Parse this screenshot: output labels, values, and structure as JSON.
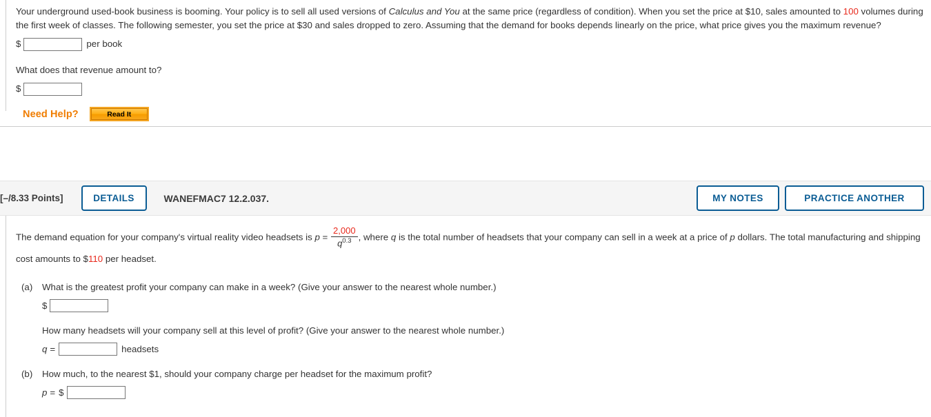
{
  "question1": {
    "stem_parts": {
      "t1": "Your underground used-book business is booming. Your policy is to sell all used versions of ",
      "title": "Calculus and You",
      "t2": " at the same price (regardless of condition). When you set the price at $10, sales amounted to ",
      "highlight1": "100",
      "t3": " volumes during the first week of classes. The following semester, you set the price at $30 and sales dropped to zero. Assuming that the demand for books depends linearly on the price, what price gives you the maximum revenue?"
    },
    "answer1": {
      "currency": "$",
      "value": "",
      "unit": "per book"
    },
    "subquestion": "What does that revenue amount to?",
    "answer2": {
      "currency": "$",
      "value": ""
    },
    "need_help": {
      "label": "Need Help?",
      "read_it_label": "Read It"
    }
  },
  "question2": {
    "header": {
      "points": "[–/8.33 Points]",
      "details_label": "DETAILS",
      "assignment_code": "WANEFMAC7 12.2.037.",
      "my_notes_label": "MY NOTES",
      "practice_another_label": "PRACTICE ANOTHER"
    },
    "stem": {
      "t1": "The demand equation for your company's virtual reality video headsets is ",
      "var_p": "p",
      "equals": " = ",
      "fraction_numerator": "2,000",
      "fraction_denominator_var": "q",
      "fraction_denominator_exp": "0.3",
      "t2": ", where ",
      "var_q": "q",
      "t3": " is the total number of headsets that your company can sell in a week at a price of ",
      "var_p2": "p",
      "t4": " dollars. The total manufacturing and shipping cost amounts to $",
      "cost_highlight": "110",
      "t5": " per headset."
    },
    "parts": [
      {
        "label": "(a)",
        "question": "What is the greatest profit your company can make in a week? (Give your answer to the nearest whole number.)",
        "input_prefix": "$",
        "input_value": "",
        "input_suffix": "",
        "question2": "How many headsets will your company sell at this level of profit? (Give your answer to the nearest whole number.)",
        "input2_var": "q",
        "input2_eq": "=",
        "input2_value": "",
        "input2_suffix": "headsets"
      },
      {
        "label": "(b)",
        "question": "How much, to the nearest $1, should your company charge per headset for the maximum profit?",
        "input_var": "p",
        "input_eq": "=",
        "input_prefix": "$",
        "input_value": ""
      }
    ]
  },
  "colors": {
    "highlight_red": "#e8291c",
    "accent_blue": "#0a5c94",
    "need_help_orange": "#f07d00",
    "header_bg": "#f5f5f5"
  }
}
